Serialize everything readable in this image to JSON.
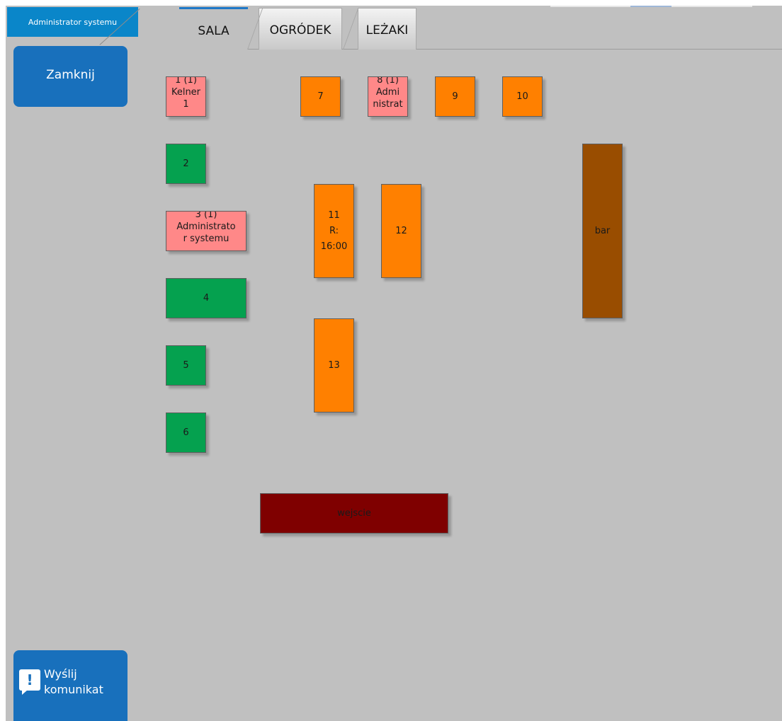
{
  "user": {
    "name": "Administrator systemu"
  },
  "sidebar": {
    "close_label": "Zamknij",
    "message_label": "Wyślij\nkomunikat",
    "message_icon": "message-alert-icon"
  },
  "tabs": [
    {
      "label": "SALA",
      "active": true
    },
    {
      "label": "OGRÓDEK",
      "active": false
    },
    {
      "label": "LEŻAKI",
      "active": false
    }
  ],
  "colors": {
    "free": "#05a14f",
    "occupied": "#ff8888",
    "reserved": "#ff8000",
    "bar": "#994d00",
    "entrance": "#7f0000",
    "accent": "#1870bc"
  },
  "floor": {
    "t1": "1 (1)\nKelner\n1",
    "t2": "2",
    "t3": "3 (1)\nAdministrato\nr systemu",
    "t4": "4",
    "t5": "5",
    "t6": "6",
    "t7": "7",
    "t8": "8 (1)\nAdmi\nnistrat",
    "t9": "9",
    "t10": "10",
    "t11": "11\nR:\n16:00",
    "t12": "12",
    "t13": "13",
    "bar": "bar",
    "entrance": "wejscie"
  }
}
